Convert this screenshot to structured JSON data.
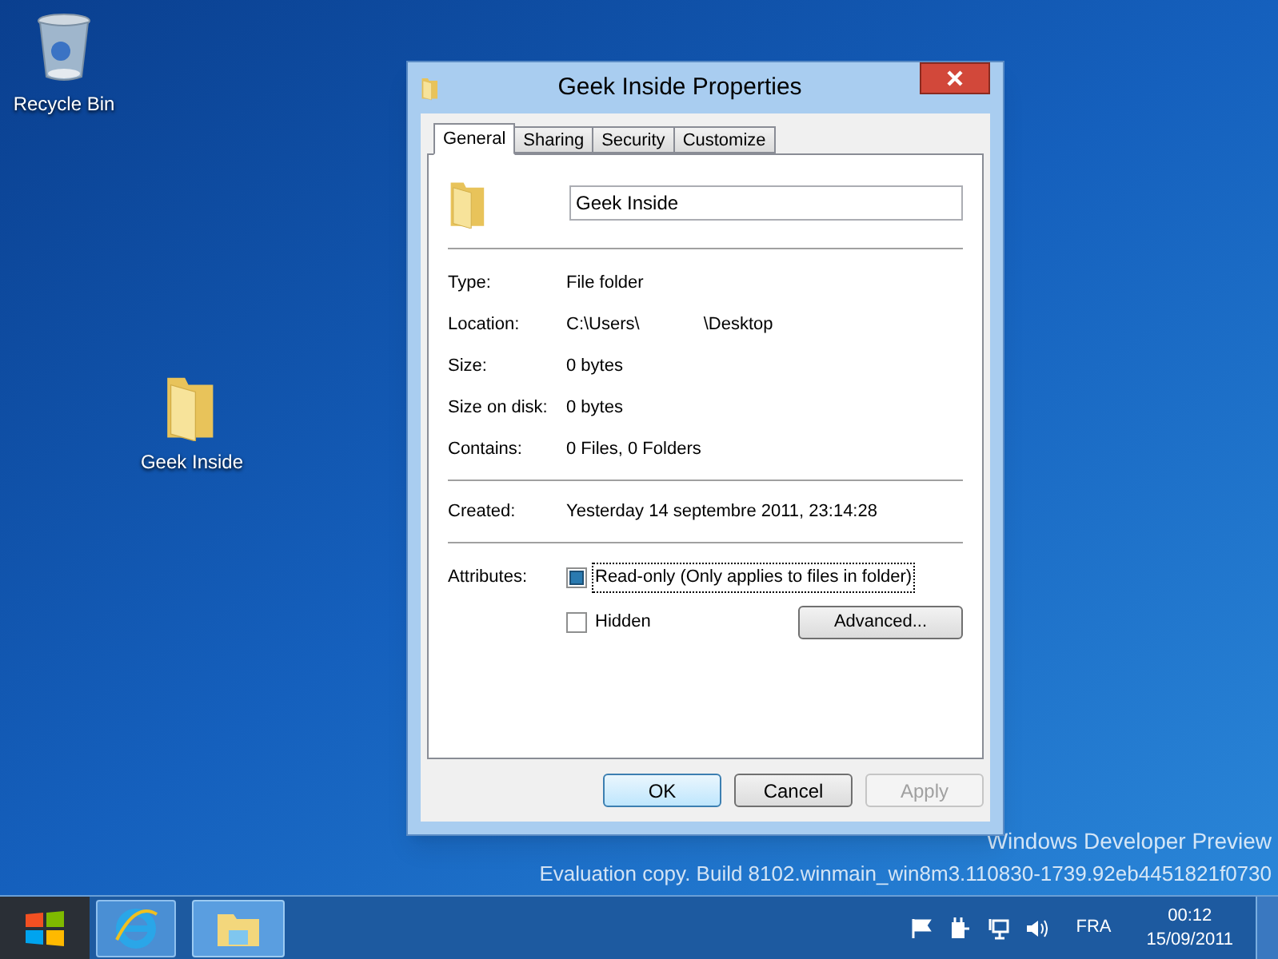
{
  "desktop_icons": [
    {
      "kind": "recycle",
      "label": "Recycle Bin"
    },
    {
      "kind": "folder",
      "label": "Geek Inside"
    }
  ],
  "window": {
    "title": "Geek Inside Properties"
  },
  "tabs": [
    {
      "label": "General",
      "selected": true
    },
    {
      "label": "Sharing",
      "selected": false
    },
    {
      "label": "Security",
      "selected": false
    },
    {
      "label": "Customize",
      "selected": false
    }
  ],
  "name_field": {
    "value": "Geek Inside"
  },
  "details": [
    {
      "label": "Type:",
      "value": "File folder"
    },
    {
      "label": "Location:",
      "value": "C:\\Users\\",
      "value_after_gap": "\\Desktop"
    },
    {
      "label": "Size:",
      "value": "0 bytes"
    },
    {
      "label": "Size on disk:",
      "value": "0 bytes"
    },
    {
      "label": "Contains:",
      "value": "0 Files, 0 Folders"
    }
  ],
  "created": {
    "label": "Created:",
    "value": "Yesterday 14 septembre 2011, 23:14:28"
  },
  "attributes": {
    "label": "Attributes:",
    "options": [
      {
        "label": "Read-only (Only applies to files in folder)",
        "checked": true,
        "focused": true
      },
      {
        "label": "Hidden",
        "checked": false,
        "focused": false
      }
    ],
    "advanced_button": "Advanced..."
  },
  "buttons": [
    {
      "label": "OK",
      "disabled": false,
      "default": true
    },
    {
      "label": "Cancel",
      "disabled": false,
      "default": false
    },
    {
      "label": "Apply",
      "disabled": true,
      "default": false
    }
  ],
  "watermark": [
    "Windows Developer Preview",
    "Evaluation copy. Build 8102.winmain_win8m3.110830-1739.92eb4451821f0730"
  ],
  "taskbar": {
    "language": "FRA",
    "time": "00:12",
    "date": "15/09/2011"
  }
}
